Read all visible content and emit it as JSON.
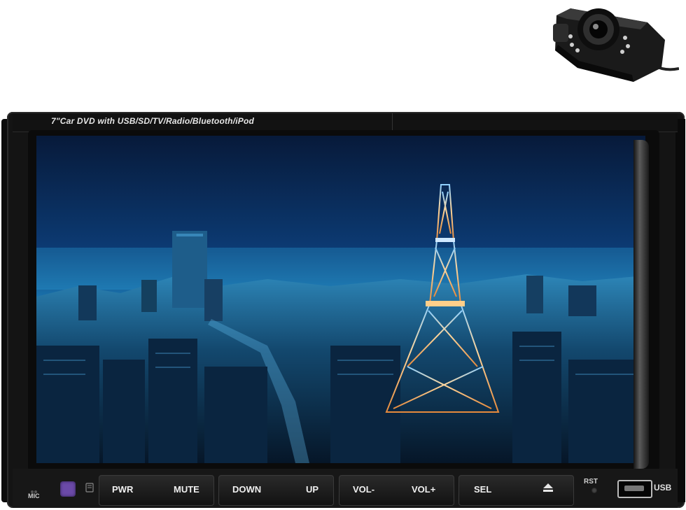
{
  "unit": {
    "model_label": "7\"Car DVD with USB/SD/TV/Radio/Bluetooth/iPod"
  },
  "screen": {
    "wallpaper_icon": "city-night-tower-wallpaper"
  },
  "buttons": {
    "pwr": "PWR",
    "mute": "MUTE",
    "down": "DOWN",
    "up": "UP",
    "vol_minus": "VOL-",
    "vol_plus": "VOL+",
    "sel": "SEL",
    "eject_icon": "eject-icon"
  },
  "panel": {
    "mic_label": "MIC",
    "rst_label": "RST",
    "usb_label": "USB"
  },
  "colors": {
    "ir_window": "#6b4aa8",
    "screen_sky": "#0b3f78",
    "tower_glow": "#f0a050"
  }
}
